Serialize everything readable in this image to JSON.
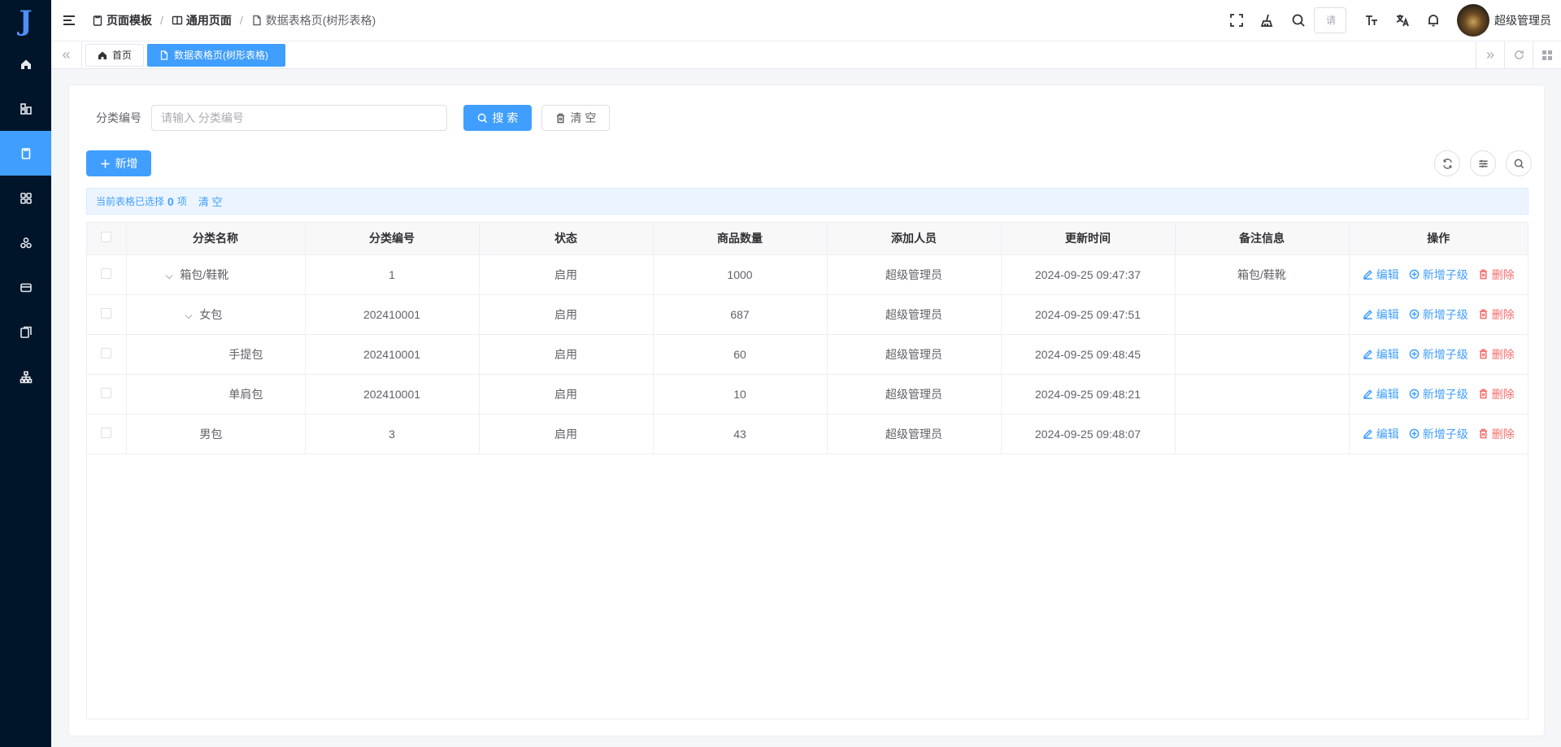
{
  "sidebar": {
    "logo": "J",
    "items": [
      {
        "icon": "home-icon"
      },
      {
        "icon": "component-icon"
      },
      {
        "icon": "page-icon",
        "active": true
      },
      {
        "icon": "apps-icon"
      },
      {
        "icon": "modules-icon"
      },
      {
        "icon": "card-icon"
      },
      {
        "icon": "documents-icon"
      },
      {
        "icon": "org-tree-icon"
      }
    ]
  },
  "header": {
    "breadcrumb": [
      "页面模板",
      "通用页面",
      "数据表格页(树形表格)"
    ],
    "search_placeholder": "请",
    "user_name": "超级管理员"
  },
  "tabs": [
    {
      "label": "首页",
      "active": false
    },
    {
      "label": "数据表格页(树形表格)",
      "active": true
    }
  ],
  "filter": {
    "label": "分类编号",
    "placeholder": "请输入 分类编号",
    "search_label": "搜 索",
    "clear_label": "清 空"
  },
  "toolbar": {
    "add_label": "新增"
  },
  "selection": {
    "prefix": "当前表格已选择",
    "count": "0",
    "suffix": "项",
    "clear_label": "清 空"
  },
  "table": {
    "columns": [
      "分类名称",
      "分类编号",
      "状态",
      "商品数量",
      "添加人员",
      "更新时间",
      "备注信息",
      "操作"
    ],
    "rows": [
      {
        "name": "箱包/鞋靴",
        "level": 0,
        "expandable": true,
        "code": "1",
        "status": "启用",
        "count": "1000",
        "creator": "超级管理员",
        "updated": "2024-09-25 09:47:37",
        "remark": "箱包/鞋靴"
      },
      {
        "name": "女包",
        "level": 1,
        "expandable": true,
        "code": "202410001",
        "status": "启用",
        "count": "687",
        "creator": "超级管理员",
        "updated": "2024-09-25 09:47:51",
        "remark": ""
      },
      {
        "name": "手提包",
        "level": 2,
        "expandable": false,
        "code": "202410001",
        "status": "启用",
        "count": "60",
        "creator": "超级管理员",
        "updated": "2024-09-25 09:48:45",
        "remark": ""
      },
      {
        "name": "单肩包",
        "level": 2,
        "expandable": false,
        "code": "202410001",
        "status": "启用",
        "count": "10",
        "creator": "超级管理员",
        "updated": "2024-09-25 09:48:21",
        "remark": ""
      },
      {
        "name": "男包",
        "level": 1,
        "expandable": false,
        "code": "3",
        "status": "启用",
        "count": "43",
        "creator": "超级管理员",
        "updated": "2024-09-25 09:48:07",
        "remark": ""
      }
    ],
    "actions": {
      "edit": "编辑",
      "add_child": "新增子级",
      "delete": "删除"
    }
  },
  "colors": {
    "primary": "#409eff",
    "danger": "#f56c6c",
    "sidebar": "#001529"
  }
}
